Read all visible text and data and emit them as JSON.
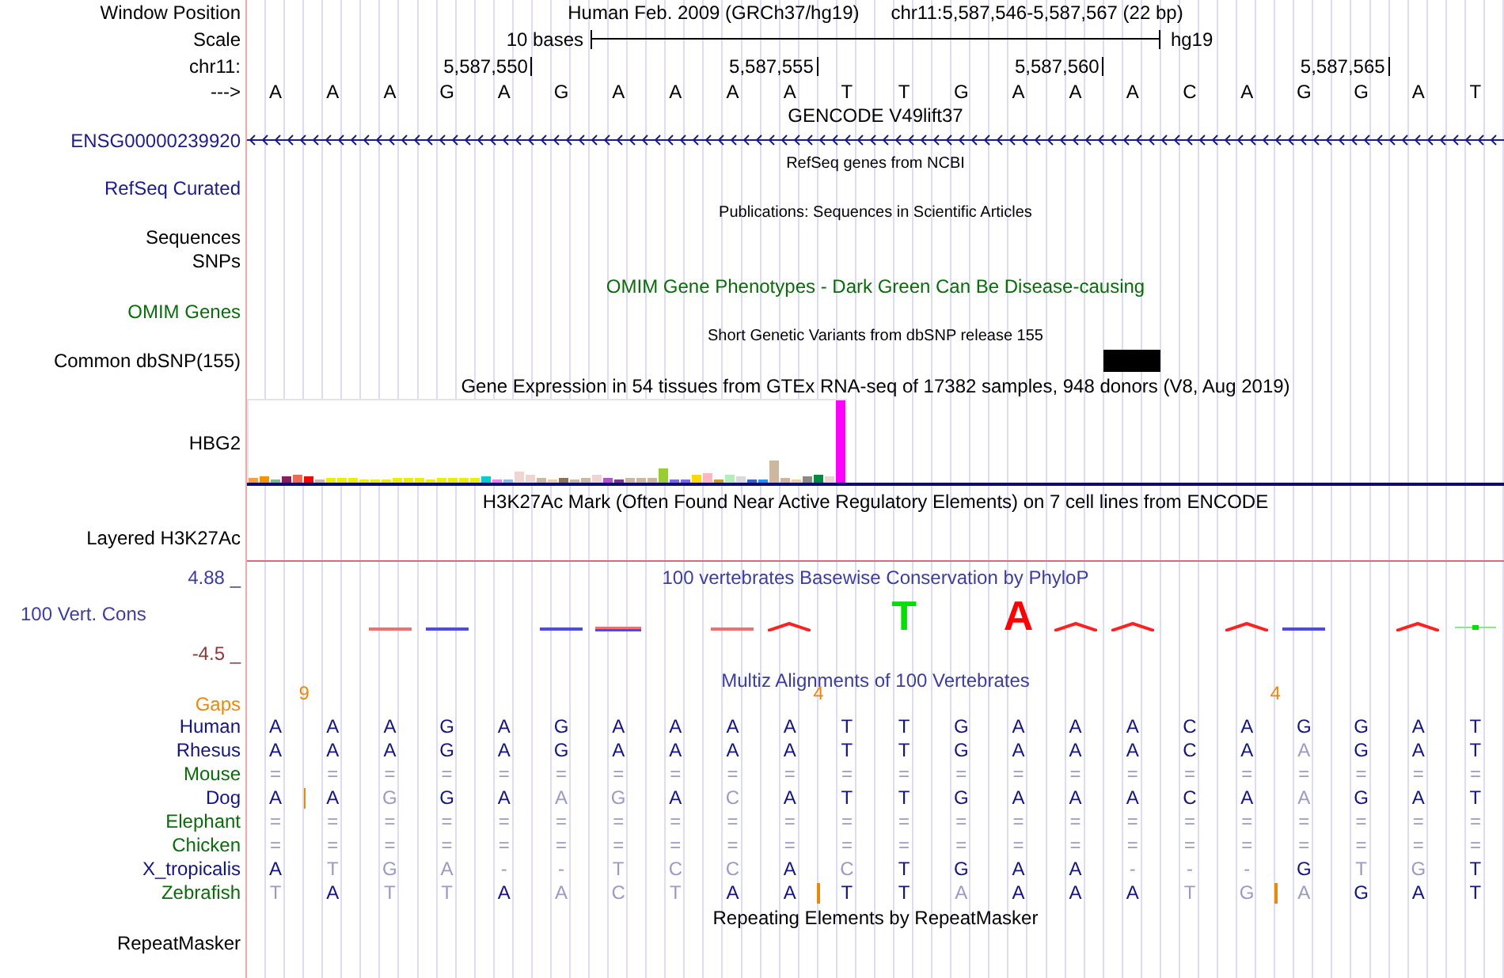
{
  "header": {
    "label": "Window Position",
    "assembly": "Human Feb. 2009 (GRCh37/hg19)",
    "position": "chr11:5,587,546-5,587,567 (22 bp)"
  },
  "scale": {
    "label": "Scale",
    "bar_label": "10 bases",
    "db": "hg19"
  },
  "ruler": {
    "label": "chr11:",
    "ticks": [
      "5,587,550",
      "5,587,555",
      "5,587,560",
      "5,587,565"
    ]
  },
  "sequence": {
    "label": "--->",
    "bases": [
      "A",
      "A",
      "A",
      "G",
      "A",
      "G",
      "A",
      "A",
      "A",
      "A",
      "T",
      "T",
      "G",
      "A",
      "A",
      "A",
      "C",
      "A",
      "G",
      "G",
      "A",
      "T"
    ]
  },
  "tracks": [
    {
      "kind": "gene-model",
      "title": "GENCODE V49lift37",
      "label": "ENSG00000239920"
    },
    {
      "kind": "gene-list",
      "title": "RefSeq genes from NCBI",
      "label": "RefSeq Curated"
    },
    {
      "kind": "publications",
      "title": "Publications: Sequences in Scientific Articles",
      "labels": [
        "Sequences",
        "SNPs"
      ]
    },
    {
      "kind": "phenotype",
      "title": "OMIM Gene Phenotypes - Dark Green Can Be Disease-causing",
      "label": "OMIM Genes"
    },
    {
      "kind": "variants",
      "title": "Short Genetic Variants from dbSNP release 155",
      "label": "Common dbSNP(155)",
      "cells": [
        {
          "kind": "empty"
        },
        {
          "kind": "empty"
        },
        {
          "kind": "empty"
        },
        {
          "kind": "empty"
        },
        {
          "kind": "empty"
        },
        {
          "kind": "empty"
        },
        {
          "kind": "empty"
        },
        {
          "kind": "empty"
        },
        {
          "kind": "empty"
        },
        {
          "kind": "empty"
        },
        {
          "kind": "empty"
        },
        {
          "kind": "empty"
        },
        {
          "kind": "empty"
        },
        {
          "kind": "empty"
        },
        {
          "kind": "empty"
        },
        {
          "kind": "variant"
        },
        {
          "kind": "empty"
        },
        {
          "kind": "empty"
        },
        {
          "kind": "empty"
        },
        {
          "kind": "empty"
        },
        {
          "kind": "empty"
        },
        {
          "kind": "empty"
        }
      ]
    },
    {
      "kind": "expression",
      "title": "Gene Expression in 54 tissues from GTEx RNA-seq of 17382 samples, 948 donors (V8, Aug 2019)",
      "label": "HBG2"
    },
    {
      "kind": "layered-signal",
      "title": "H3K27Ac Mark (Often Found Near Active Regulatory Elements) on 7 cell lines from ENCODE",
      "label": "Layered H3K27Ac"
    },
    {
      "kind": "conservation",
      "title": "100 vertebrates Basewise Conservation by PhyloP",
      "label": "100 Vert. Cons",
      "max": "4.88 _",
      "min": "-4.5 _",
      "cells": [
        {
          "kind": "none"
        },
        {
          "kind": "none"
        },
        {
          "kind": "red-line"
        },
        {
          "kind": "blue-line"
        },
        {
          "kind": "none"
        },
        {
          "kind": "blue-line"
        },
        {
          "kind": "mixed-line"
        },
        {
          "kind": "none"
        },
        {
          "kind": "red-line"
        },
        {
          "kind": "red-hump"
        },
        {
          "kind": "none"
        },
        {
          "kind": "letter",
          "letter": "T",
          "color": "#00e000"
        },
        {
          "kind": "none"
        },
        {
          "kind": "letter",
          "letter": "A",
          "color": "#ff0000"
        },
        {
          "kind": "red-hump"
        },
        {
          "kind": "red-hump"
        },
        {
          "kind": "none"
        },
        {
          "kind": "red-hump"
        },
        {
          "kind": "blue-line"
        },
        {
          "kind": "none"
        },
        {
          "kind": "red-hump"
        },
        {
          "kind": "green-line"
        }
      ]
    },
    {
      "kind": "alignment",
      "title": "Multiz Alignments of 100 Vertebrates",
      "gaps": {
        "label": "Gaps",
        "marks": [
          {
            "kind": "count",
            "count": "9"
          },
          {
            "kind": "none"
          },
          {
            "kind": "none"
          },
          {
            "kind": "none"
          },
          {
            "kind": "none"
          },
          {
            "kind": "none"
          },
          {
            "kind": "none"
          },
          {
            "kind": "none"
          },
          {
            "kind": "none"
          },
          {
            "kind": "count",
            "count": "4"
          },
          {
            "kind": "none"
          },
          {
            "kind": "none"
          },
          {
            "kind": "none"
          },
          {
            "kind": "none"
          },
          {
            "kind": "none"
          },
          {
            "kind": "none"
          },
          {
            "kind": "none"
          },
          {
            "kind": "count",
            "count": "4"
          },
          {
            "kind": "none"
          },
          {
            "kind": "none"
          },
          {
            "kind": "none"
          },
          {
            "kind": "none"
          }
        ]
      },
      "species": [
        {
          "name": "Human",
          "color": "#15157e",
          "cells": [
            {
              "t": "A",
              "dim": false,
              "kind": "plain"
            },
            {
              "t": "A",
              "dim": false,
              "kind": "plain"
            },
            {
              "t": "A",
              "dim": false,
              "kind": "plain"
            },
            {
              "t": "G",
              "dim": false,
              "kind": "plain"
            },
            {
              "t": "A",
              "dim": false,
              "kind": "plain"
            },
            {
              "t": "G",
              "dim": false,
              "kind": "plain"
            },
            {
              "t": "A",
              "dim": false,
              "kind": "plain"
            },
            {
              "t": "A",
              "dim": false,
              "kind": "plain"
            },
            {
              "t": "A",
              "dim": false,
              "kind": "plain"
            },
            {
              "t": "A",
              "dim": false,
              "kind": "plain"
            },
            {
              "t": "T",
              "dim": false,
              "kind": "plain"
            },
            {
              "t": "T",
              "dim": false,
              "kind": "plain"
            },
            {
              "t": "G",
              "dim": false,
              "kind": "plain"
            },
            {
              "t": "A",
              "dim": false,
              "kind": "plain"
            },
            {
              "t": "A",
              "dim": false,
              "kind": "plain"
            },
            {
              "t": "A",
              "dim": false,
              "kind": "plain"
            },
            {
              "t": "C",
              "dim": false,
              "kind": "plain"
            },
            {
              "t": "A",
              "dim": false,
              "kind": "plain"
            },
            {
              "t": "G",
              "dim": false,
              "kind": "plain"
            },
            {
              "t": "G",
              "dim": false,
              "kind": "plain"
            },
            {
              "t": "A",
              "dim": false,
              "kind": "plain"
            },
            {
              "t": "T",
              "dim": false,
              "kind": "plain"
            }
          ]
        },
        {
          "name": "Rhesus",
          "color": "#15157e",
          "cells": [
            {
              "t": "A",
              "dim": false,
              "kind": "plain"
            },
            {
              "t": "A",
              "dim": false,
              "kind": "plain"
            },
            {
              "t": "A",
              "dim": false,
              "kind": "plain"
            },
            {
              "t": "G",
              "dim": false,
              "kind": "plain"
            },
            {
              "t": "A",
              "dim": false,
              "kind": "plain"
            },
            {
              "t": "G",
              "dim": false,
              "kind": "plain"
            },
            {
              "t": "A",
              "dim": false,
              "kind": "plain"
            },
            {
              "t": "A",
              "dim": false,
              "kind": "plain"
            },
            {
              "t": "A",
              "dim": false,
              "kind": "plain"
            },
            {
              "t": "A",
              "dim": false,
              "kind": "plain"
            },
            {
              "t": "T",
              "dim": false,
              "kind": "plain"
            },
            {
              "t": "T",
              "dim": false,
              "kind": "plain"
            },
            {
              "t": "G",
              "dim": false,
              "kind": "plain"
            },
            {
              "t": "A",
              "dim": false,
              "kind": "plain"
            },
            {
              "t": "A",
              "dim": false,
              "kind": "plain"
            },
            {
              "t": "A",
              "dim": false,
              "kind": "plain"
            },
            {
              "t": "C",
              "dim": false,
              "kind": "plain"
            },
            {
              "t": "A",
              "dim": false,
              "kind": "plain"
            },
            {
              "t": "A",
              "dim": true,
              "kind": "plain"
            },
            {
              "t": "G",
              "dim": false,
              "kind": "plain"
            },
            {
              "t": "A",
              "dim": false,
              "kind": "plain"
            },
            {
              "t": "T",
              "dim": false,
              "kind": "plain"
            }
          ]
        },
        {
          "name": "Mouse",
          "color": "#0b6b0b",
          "cells": [
            {
              "t": "=",
              "dim": true,
              "kind": "plain"
            },
            {
              "t": "=",
              "dim": true,
              "kind": "plain"
            },
            {
              "t": "=",
              "dim": true,
              "kind": "plain"
            },
            {
              "t": "=",
              "dim": true,
              "kind": "plain"
            },
            {
              "t": "=",
              "dim": true,
              "kind": "plain"
            },
            {
              "t": "=",
              "dim": true,
              "kind": "plain"
            },
            {
              "t": "=",
              "dim": true,
              "kind": "plain"
            },
            {
              "t": "=",
              "dim": true,
              "kind": "plain"
            },
            {
              "t": "=",
              "dim": true,
              "kind": "plain"
            },
            {
              "t": "=",
              "dim": true,
              "kind": "plain"
            },
            {
              "t": "=",
              "dim": true,
              "kind": "plain"
            },
            {
              "t": "=",
              "dim": true,
              "kind": "plain"
            },
            {
              "t": "=",
              "dim": true,
              "kind": "plain"
            },
            {
              "t": "=",
              "dim": true,
              "kind": "plain"
            },
            {
              "t": "=",
              "dim": true,
              "kind": "plain"
            },
            {
              "t": "=",
              "dim": true,
              "kind": "plain"
            },
            {
              "t": "=",
              "dim": true,
              "kind": "plain"
            },
            {
              "t": "=",
              "dim": true,
              "kind": "plain"
            },
            {
              "t": "=",
              "dim": true,
              "kind": "plain"
            },
            {
              "t": "=",
              "dim": true,
              "kind": "plain"
            },
            {
              "t": "=",
              "dim": true,
              "kind": "plain"
            },
            {
              "t": "=",
              "dim": true,
              "kind": "plain"
            }
          ]
        },
        {
          "name": "Dog",
          "color": "#15157e",
          "cells": [
            {
              "t": "A",
              "dim": false,
              "kind": "insertion-after"
            },
            {
              "t": "A",
              "dim": false,
              "kind": "plain"
            },
            {
              "t": "G",
              "dim": true,
              "kind": "plain"
            },
            {
              "t": "G",
              "dim": false,
              "kind": "plain"
            },
            {
              "t": "A",
              "dim": false,
              "kind": "plain"
            },
            {
              "t": "A",
              "dim": true,
              "kind": "plain"
            },
            {
              "t": "G",
              "dim": true,
              "kind": "plain"
            },
            {
              "t": "A",
              "dim": false,
              "kind": "plain"
            },
            {
              "t": "C",
              "dim": true,
              "kind": "plain"
            },
            {
              "t": "A",
              "dim": false,
              "kind": "plain"
            },
            {
              "t": "T",
              "dim": false,
              "kind": "plain"
            },
            {
              "t": "T",
              "dim": false,
              "kind": "plain"
            },
            {
              "t": "G",
              "dim": false,
              "kind": "plain"
            },
            {
              "t": "A",
              "dim": false,
              "kind": "plain"
            },
            {
              "t": "A",
              "dim": false,
              "kind": "plain"
            },
            {
              "t": "A",
              "dim": false,
              "kind": "plain"
            },
            {
              "t": "C",
              "dim": false,
              "kind": "plain"
            },
            {
              "t": "A",
              "dim": false,
              "kind": "plain"
            },
            {
              "t": "A",
              "dim": true,
              "kind": "plain"
            },
            {
              "t": "G",
              "dim": false,
              "kind": "plain"
            },
            {
              "t": "A",
              "dim": false,
              "kind": "plain"
            },
            {
              "t": "T",
              "dim": false,
              "kind": "plain"
            }
          ]
        },
        {
          "name": "Elephant",
          "color": "#0b6b0b",
          "cells": [
            {
              "t": "=",
              "dim": true,
              "kind": "plain"
            },
            {
              "t": "=",
              "dim": true,
              "kind": "plain"
            },
            {
              "t": "=",
              "dim": true,
              "kind": "plain"
            },
            {
              "t": "=",
              "dim": true,
              "kind": "plain"
            },
            {
              "t": "=",
              "dim": true,
              "kind": "plain"
            },
            {
              "t": "=",
              "dim": true,
              "kind": "plain"
            },
            {
              "t": "=",
              "dim": true,
              "kind": "plain"
            },
            {
              "t": "=",
              "dim": true,
              "kind": "plain"
            },
            {
              "t": "=",
              "dim": true,
              "kind": "plain"
            },
            {
              "t": "=",
              "dim": true,
              "kind": "plain"
            },
            {
              "t": "=",
              "dim": true,
              "kind": "plain"
            },
            {
              "t": "=",
              "dim": true,
              "kind": "plain"
            },
            {
              "t": "=",
              "dim": true,
              "kind": "plain"
            },
            {
              "t": "=",
              "dim": true,
              "kind": "plain"
            },
            {
              "t": "=",
              "dim": true,
              "kind": "plain"
            },
            {
              "t": "=",
              "dim": true,
              "kind": "plain"
            },
            {
              "t": "=",
              "dim": true,
              "kind": "plain"
            },
            {
              "t": "=",
              "dim": true,
              "kind": "plain"
            },
            {
              "t": "=",
              "dim": true,
              "kind": "plain"
            },
            {
              "t": "=",
              "dim": true,
              "kind": "plain"
            },
            {
              "t": "=",
              "dim": true,
              "kind": "plain"
            },
            {
              "t": "=",
              "dim": true,
              "kind": "plain"
            }
          ]
        },
        {
          "name": "Chicken",
          "color": "#0b6b0b",
          "cells": [
            {
              "t": "=",
              "dim": true,
              "kind": "plain"
            },
            {
              "t": "=",
              "dim": true,
              "kind": "plain"
            },
            {
              "t": "=",
              "dim": true,
              "kind": "plain"
            },
            {
              "t": "=",
              "dim": true,
              "kind": "plain"
            },
            {
              "t": "=",
              "dim": true,
              "kind": "plain"
            },
            {
              "t": "=",
              "dim": true,
              "kind": "plain"
            },
            {
              "t": "=",
              "dim": true,
              "kind": "plain"
            },
            {
              "t": "=",
              "dim": true,
              "kind": "plain"
            },
            {
              "t": "=",
              "dim": true,
              "kind": "plain"
            },
            {
              "t": "=",
              "dim": true,
              "kind": "plain"
            },
            {
              "t": "=",
              "dim": true,
              "kind": "plain"
            },
            {
              "t": "=",
              "dim": true,
              "kind": "plain"
            },
            {
              "t": "=",
              "dim": true,
              "kind": "plain"
            },
            {
              "t": "=",
              "dim": true,
              "kind": "plain"
            },
            {
              "t": "=",
              "dim": true,
              "kind": "plain"
            },
            {
              "t": "=",
              "dim": true,
              "kind": "plain"
            },
            {
              "t": "=",
              "dim": true,
              "kind": "plain"
            },
            {
              "t": "=",
              "dim": true,
              "kind": "plain"
            },
            {
              "t": "=",
              "dim": true,
              "kind": "plain"
            },
            {
              "t": "=",
              "dim": true,
              "kind": "plain"
            },
            {
              "t": "=",
              "dim": true,
              "kind": "plain"
            },
            {
              "t": "=",
              "dim": true,
              "kind": "plain"
            }
          ]
        },
        {
          "name": "X_tropicalis",
          "color": "#15157e",
          "cells": [
            {
              "t": "A",
              "dim": false,
              "kind": "plain"
            },
            {
              "t": "T",
              "dim": true,
              "kind": "plain"
            },
            {
              "t": "G",
              "dim": true,
              "kind": "plain"
            },
            {
              "t": "A",
              "dim": true,
              "kind": "plain"
            },
            {
              "t": "-",
              "dim": true,
              "kind": "plain"
            },
            {
              "t": "-",
              "dim": true,
              "kind": "plain"
            },
            {
              "t": "T",
              "dim": true,
              "kind": "plain"
            },
            {
              "t": "C",
              "dim": true,
              "kind": "plain"
            },
            {
              "t": "C",
              "dim": true,
              "kind": "plain"
            },
            {
              "t": "A",
              "dim": false,
              "kind": "plain"
            },
            {
              "t": "C",
              "dim": true,
              "kind": "plain"
            },
            {
              "t": "T",
              "dim": false,
              "kind": "plain"
            },
            {
              "t": "G",
              "dim": false,
              "kind": "plain"
            },
            {
              "t": "A",
              "dim": false,
              "kind": "plain"
            },
            {
              "t": "A",
              "dim": false,
              "kind": "plain"
            },
            {
              "t": "-",
              "dim": true,
              "kind": "plain"
            },
            {
              "t": "-",
              "dim": true,
              "kind": "plain"
            },
            {
              "t": "-",
              "dim": true,
              "kind": "plain"
            },
            {
              "t": "G",
              "dim": false,
              "kind": "plain"
            },
            {
              "t": "T",
              "dim": true,
              "kind": "plain"
            },
            {
              "t": "G",
              "dim": true,
              "kind": "plain"
            },
            {
              "t": "T",
              "dim": false,
              "kind": "plain"
            }
          ]
        },
        {
          "name": "Zebrafish",
          "color": "#0b6b0b",
          "cells": [
            {
              "t": "T",
              "dim": true,
              "kind": "plain"
            },
            {
              "t": "A",
              "dim": false,
              "kind": "plain"
            },
            {
              "t": "T",
              "dim": true,
              "kind": "plain"
            },
            {
              "t": "T",
              "dim": true,
              "kind": "plain"
            },
            {
              "t": "A",
              "dim": false,
              "kind": "plain"
            },
            {
              "t": "A",
              "dim": true,
              "kind": "plain"
            },
            {
              "t": "C",
              "dim": true,
              "kind": "plain"
            },
            {
              "t": "T",
              "dim": true,
              "kind": "plain"
            },
            {
              "t": "A",
              "dim": false,
              "kind": "plain"
            },
            {
              "t": "A",
              "dim": false,
              "kind": "insertion-after"
            },
            {
              "t": "T",
              "dim": false,
              "kind": "plain"
            },
            {
              "t": "T",
              "dim": false,
              "kind": "plain"
            },
            {
              "t": "A",
              "dim": true,
              "kind": "plain"
            },
            {
              "t": "A",
              "dim": false,
              "kind": "plain"
            },
            {
              "t": "A",
              "dim": false,
              "kind": "plain"
            },
            {
              "t": "A",
              "dim": false,
              "kind": "plain"
            },
            {
              "t": "T",
              "dim": true,
              "kind": "plain"
            },
            {
              "t": "G",
              "dim": true,
              "kind": "insertion-after"
            },
            {
              "t": "A",
              "dim": true,
              "kind": "plain"
            },
            {
              "t": "G",
              "dim": false,
              "kind": "plain"
            },
            {
              "t": "A",
              "dim": false,
              "kind": "plain"
            },
            {
              "t": "T",
              "dim": false,
              "kind": "plain"
            }
          ]
        }
      ]
    },
    {
      "kind": "repeats",
      "title": "Repeating Elements by RepeatMasker",
      "label": "RepeatMasker"
    }
  ]
}
